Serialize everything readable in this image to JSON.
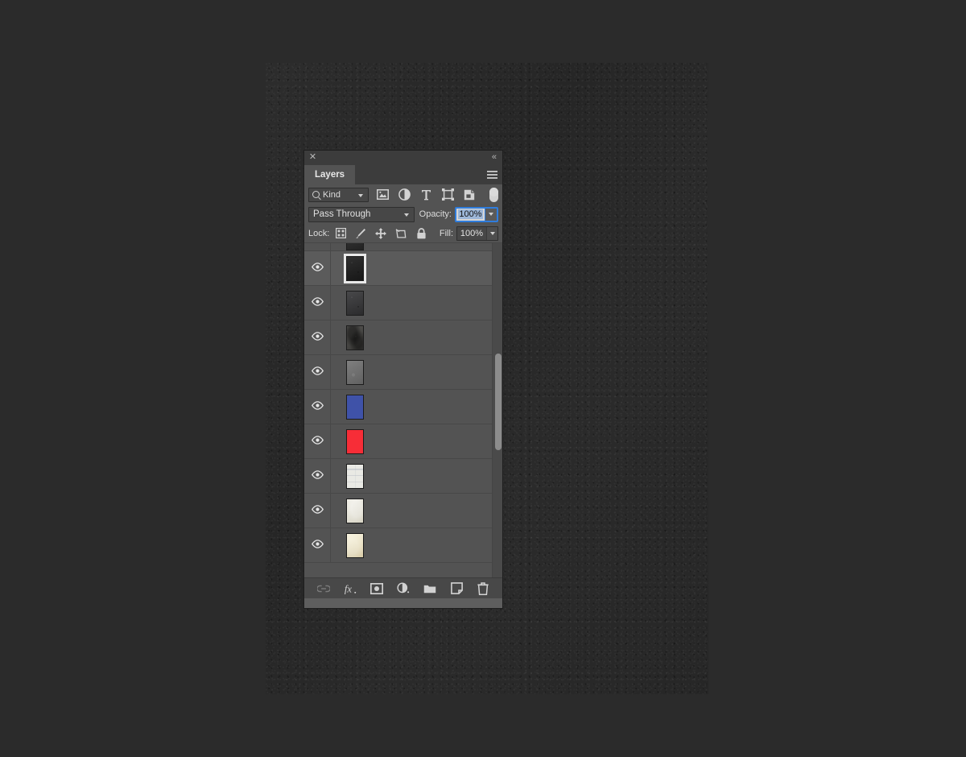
{
  "app": {
    "theme_bg": "#2b2b2b",
    "panel_bg": "#535353",
    "accent": "#2f7ddd"
  },
  "panel": {
    "close_label": "✕",
    "collapse_label": "«",
    "menu_name": "panel-menu-icon",
    "tabs": [
      {
        "label": "Layers",
        "active": true
      }
    ]
  },
  "filter": {
    "kind_label": "Kind",
    "search_icon": "search-icon",
    "icons": [
      {
        "name": "filter-pixel-layers-icon",
        "glyph": "image"
      },
      {
        "name": "filter-adjustment-layers-icon",
        "glyph": "halfcircle"
      },
      {
        "name": "filter-type-layers-icon",
        "glyph": "T"
      },
      {
        "name": "filter-shape-layers-icon",
        "glyph": "frame"
      },
      {
        "name": "filter-smart-object-layers-icon",
        "glyph": "smartobject"
      }
    ],
    "toggle_name": "filter-enable-toggle"
  },
  "blend": {
    "mode_label": "Pass Through",
    "opacity_caption": "Opacity:",
    "opacity_value": "100%"
  },
  "lock": {
    "caption": "Lock:",
    "icons": [
      {
        "name": "lock-transparent-pixels-icon"
      },
      {
        "name": "lock-image-pixels-icon"
      },
      {
        "name": "lock-position-icon"
      },
      {
        "name": "lock-artboard-nesting-icon"
      },
      {
        "name": "lock-all-icon"
      }
    ],
    "fill_caption": "Fill:",
    "fill_value": "100%"
  },
  "layers": [
    {
      "name": "",
      "thumb": "#2e2e2e",
      "texture": "dark",
      "selected": false,
      "partial": true,
      "visible": false
    },
    {
      "name": "",
      "thumb": "#1f1f1f",
      "texture": "dark",
      "selected": true,
      "partial": false,
      "visible": true
    },
    {
      "name": "",
      "thumb": "#3a3a3c",
      "texture": "dark",
      "selected": false,
      "partial": false,
      "visible": true
    },
    {
      "name": "",
      "thumb": "#4b4a47",
      "texture": "grunge",
      "selected": false,
      "partial": false,
      "visible": true
    },
    {
      "name": "",
      "thumb": "#6e6e6e",
      "texture": "light",
      "selected": false,
      "partial": false,
      "visible": true
    },
    {
      "name": "",
      "thumb": "#3f52a8",
      "texture": "flat",
      "selected": false,
      "partial": false,
      "visible": true
    },
    {
      "name": "",
      "thumb": "#f72d37",
      "texture": "flat",
      "selected": false,
      "partial": false,
      "visible": true
    },
    {
      "name": "",
      "thumb": "#e9e9e4",
      "texture": "paper-white",
      "selected": false,
      "partial": false,
      "visible": true
    },
    {
      "name": "",
      "thumb": "#e3e0d1",
      "texture": "paper-cream",
      "selected": false,
      "partial": false,
      "visible": true
    },
    {
      "name": "",
      "thumb": "#e7dcbb",
      "texture": "paper-tan",
      "selected": false,
      "partial": false,
      "visible": true
    }
  ],
  "scrollbar": {
    "thumb_top_pct": 33,
    "thumb_height_pct": 29
  },
  "footer": {
    "icons": [
      {
        "name": "link-layers-icon",
        "dim": true
      },
      {
        "name": "layer-style-fx-icon",
        "dim": false
      },
      {
        "name": "add-layer-mask-icon",
        "dim": false
      },
      {
        "name": "new-fill-adjustment-layer-icon",
        "dim": false
      },
      {
        "name": "new-group-icon",
        "dim": false
      },
      {
        "name": "new-layer-icon",
        "dim": false
      },
      {
        "name": "delete-layer-icon",
        "dim": false
      }
    ]
  }
}
